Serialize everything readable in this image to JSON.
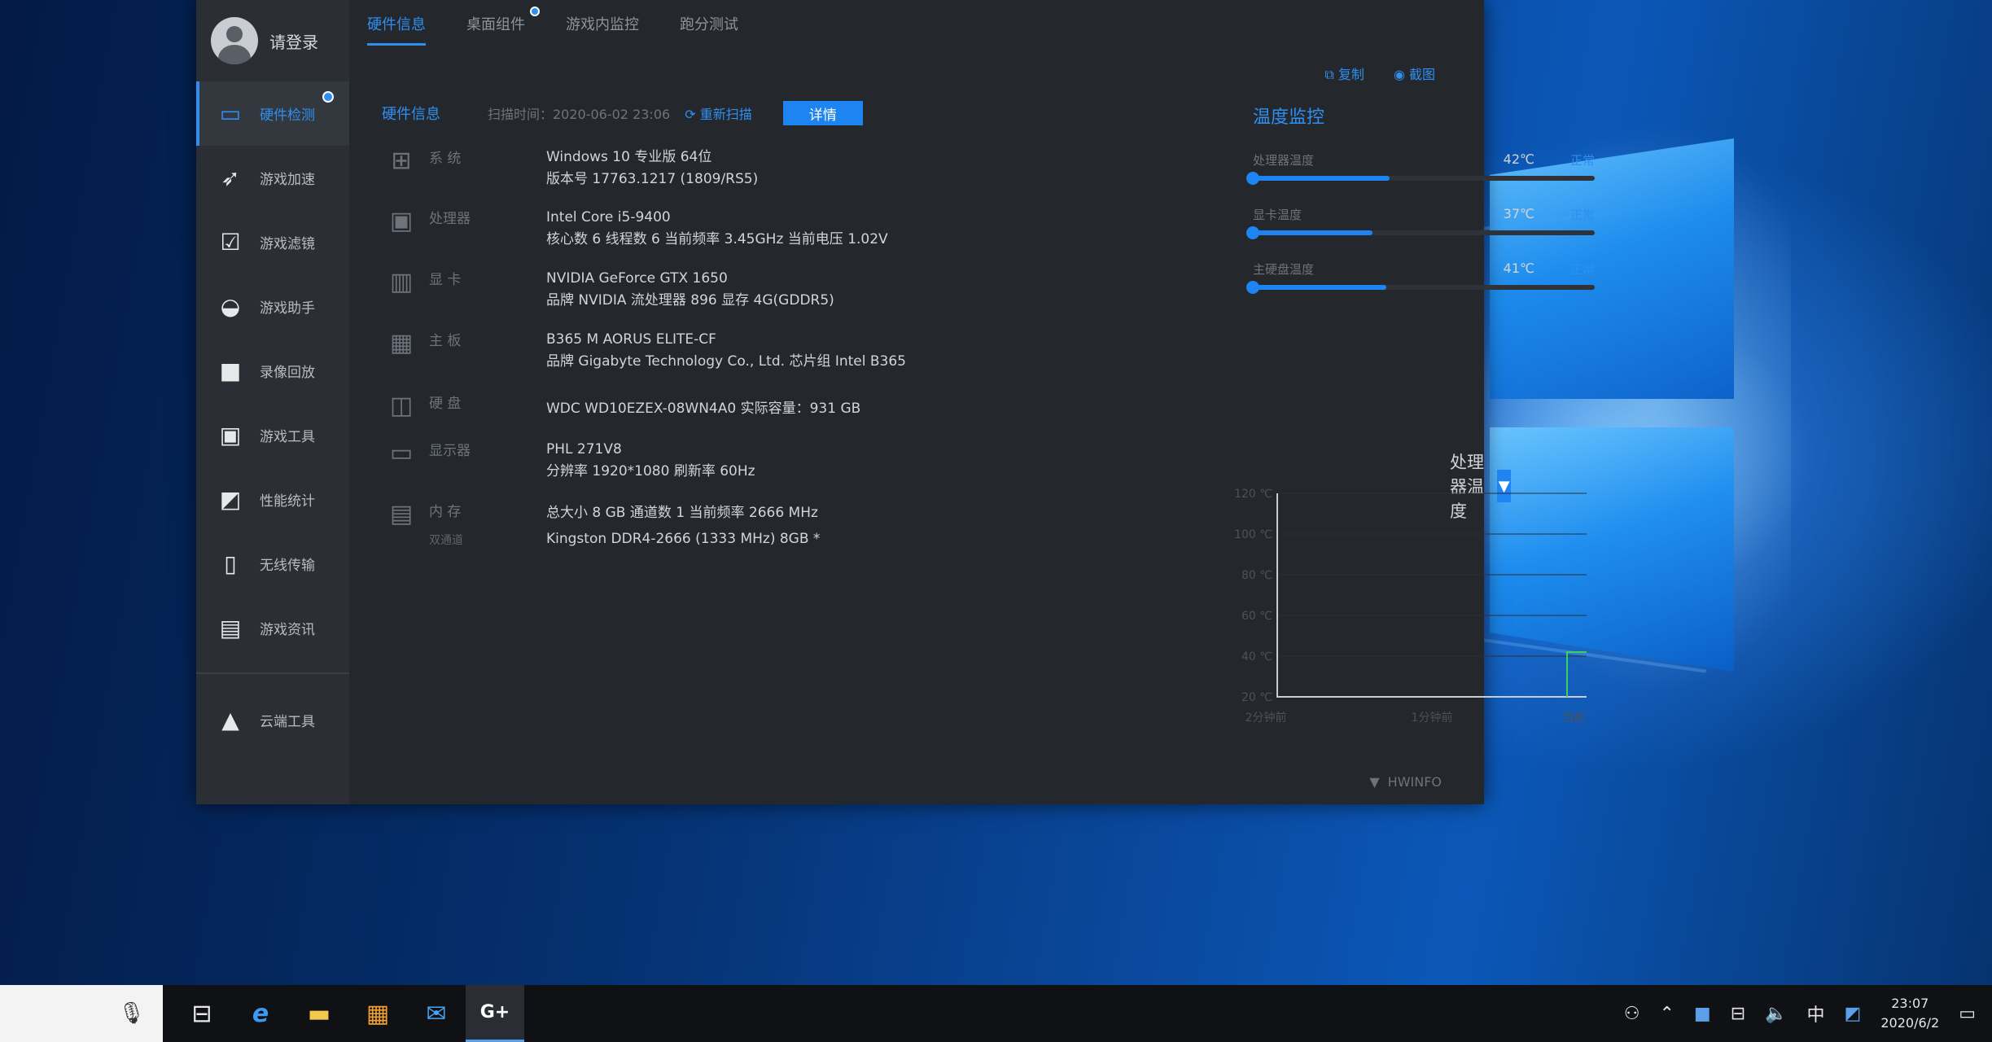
{
  "sidebar": {
    "user_name": "请登录",
    "items": [
      {
        "label": "硬件检测",
        "icon": "monitor-icon"
      },
      {
        "label": "游戏加速",
        "icon": "rocket-icon"
      },
      {
        "label": "游戏滤镜",
        "icon": "filter-icon"
      },
      {
        "label": "游戏助手",
        "icon": "gamepad-icon"
      },
      {
        "label": "录像回放",
        "icon": "camera-icon"
      },
      {
        "label": "游戏工具",
        "icon": "toolbox-icon"
      },
      {
        "label": "性能统计",
        "icon": "stats-icon"
      },
      {
        "label": "无线传输",
        "icon": "phone-icon"
      },
      {
        "label": "游戏资讯",
        "icon": "news-icon"
      }
    ],
    "bottom_item": {
      "label": "云端工具",
      "icon": "cloud-tool-icon"
    }
  },
  "tabs": [
    {
      "label": "硬件信息"
    },
    {
      "label": "桌面组件"
    },
    {
      "label": "游戏内监控"
    },
    {
      "label": "跑分测试"
    }
  ],
  "actions": {
    "export": "复制",
    "screenshot": "截图"
  },
  "hw": {
    "title": "硬件信息",
    "scan_time": "扫描时间：2020-06-02 23:06",
    "rescan": "重新扫描",
    "detail_button": "详情",
    "rows": [
      {
        "name": "系 统",
        "icon": "system-icon",
        "lines": [
          "Windows 10 专业版 64位",
          "版本号  17763.1217 (1809/RS5)"
        ]
      },
      {
        "name": "处理器",
        "icon": "cpu-icon",
        "lines": [
          "Intel Core i5-9400",
          "核心数  6    线程数  6    当前频率 3.45GHz    当前电压 1.02V"
        ]
      },
      {
        "name": "显 卡",
        "icon": "gpu-icon",
        "lines": [
          "NVIDIA GeForce GTX 1650",
          "品牌  NVIDIA    流处理器  896    显存  4G(GDDR5)"
        ]
      },
      {
        "name": "主 板",
        "icon": "motherboard-icon",
        "lines": [
          "B365 M AORUS ELITE-CF",
          "品牌  Gigabyte Technology Co., Ltd.    芯片组  Intel B365"
        ]
      },
      {
        "name": "硬 盘",
        "icon": "disk-icon",
        "lines": [
          "WDC WD10EZEX-08WN4A0                实际容量：931 GB"
        ]
      },
      {
        "name": "显示器",
        "icon": "display-icon",
        "lines": [
          "PHL 271V8",
          "分辨率  1920*1080    刷新率 60Hz"
        ]
      },
      {
        "name": "内 存",
        "sub": "双通道",
        "icon": "memory-icon",
        "lines": [
          "总大小  8 GB    通道数  1    当前频率  2666 MHz",
          "Kingston DDR4-2666 (1333 MHz) 8GB *"
        ]
      }
    ]
  },
  "temps": {
    "title": "温度监控",
    "items": [
      {
        "label": "处理器温度",
        "value": "42℃",
        "status": "正常",
        "level": 0.4
      },
      {
        "label": "显卡温度",
        "value": "37℃",
        "status": "正常",
        "level": 0.35
      },
      {
        "label": "主硬盘温度",
        "value": "41℃",
        "status": "正常",
        "level": 0.39
      }
    ]
  },
  "selector": {
    "selected": "处理器温度"
  },
  "chart_data": {
    "type": "line",
    "y_ticks": [
      "120 ℃",
      "100 ℃",
      "80 ℃",
      "60 ℃",
      "40 ℃",
      "20 ℃"
    ],
    "x_ticks": [
      "2分钟前",
      "1分钟前",
      "当前"
    ],
    "ylim": [
      20,
      120
    ],
    "series": [
      {
        "values": [
          null,
          null,
          null,
          null,
          null,
          null,
          null,
          null,
          null,
          42,
          42
        ]
      }
    ],
    "line_color": "#3ccf5a"
  },
  "footer": "HWINFO",
  "taskbar": {
    "apps": [
      {
        "icon": "task-view-icon",
        "glyph": "⊟"
      },
      {
        "icon": "edge-icon",
        "glyph": "e"
      },
      {
        "icon": "folder-icon",
        "glyph": "▬"
      },
      {
        "icon": "store-icon",
        "glyph": "▦"
      },
      {
        "icon": "mail-icon",
        "glyph": "✉"
      },
      {
        "icon": "game-plus-icon",
        "glyph": "G+"
      }
    ],
    "ime": "中",
    "time": "23:07",
    "date": "2020/6/2"
  }
}
